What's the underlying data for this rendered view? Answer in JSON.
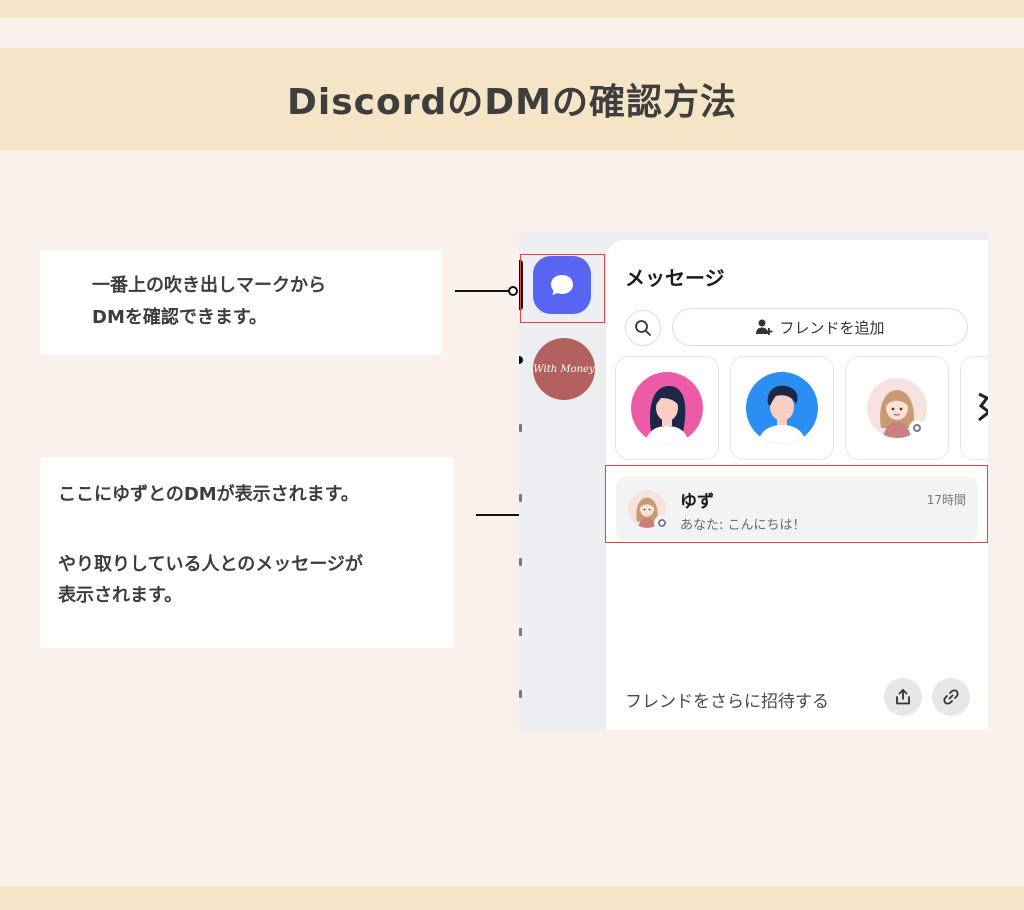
{
  "title": "DiscordのDMの確認方法",
  "note1": {
    "line1": "一番上の吹き出しマークから",
    "line2": "DMを確認できます。"
  },
  "note2": {
    "line1": "ここにゆずとのDMが表示されます。",
    "line2": "やり取りしている人とのメッセージが",
    "line3": "表示されます。"
  },
  "app": {
    "server_label": "With Money",
    "panel_title": "メッセージ",
    "add_friend_label": "フレンドを追加",
    "dm": {
      "name": "ゆず",
      "time": "17時間",
      "preview": "あなた: こんにちは！"
    },
    "invite_label": "フレンドをさらに招待する"
  },
  "colors": {
    "accent": "#5865f2",
    "band": "#f6e4c6",
    "background": "#fbf1ec",
    "highlight": "#e64040"
  }
}
